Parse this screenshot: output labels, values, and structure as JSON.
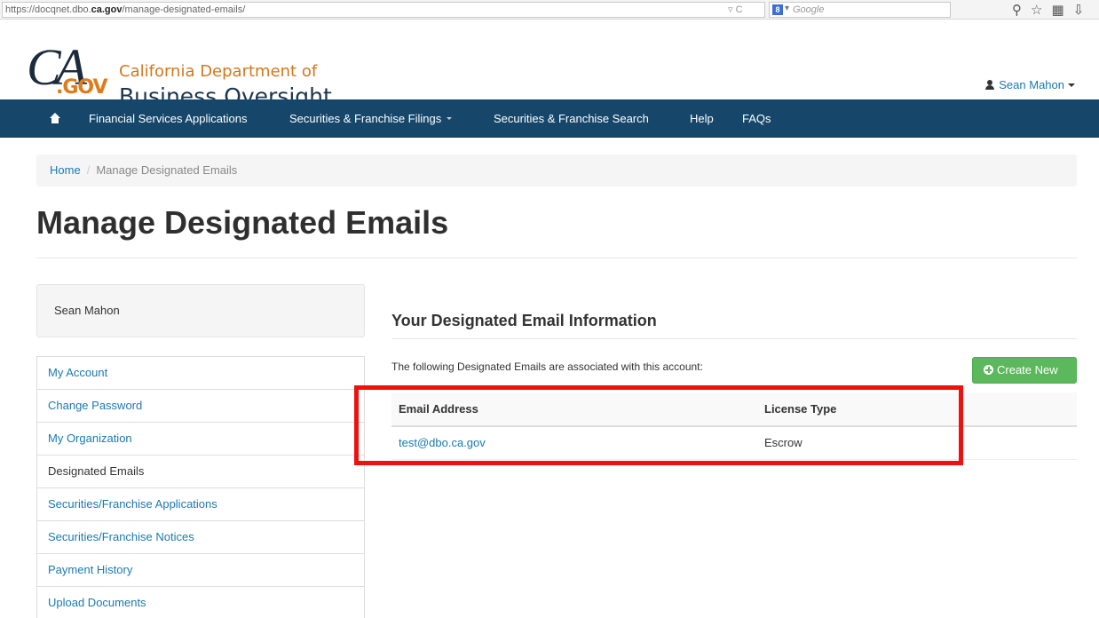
{
  "browser": {
    "url_prefix": "https://docqnet.dbo.",
    "url_domain": "ca.gov",
    "url_suffix": "/manage-designated-emails/",
    "search_placeholder": "Google",
    "search_engine_glyph": "8"
  },
  "header": {
    "logo_ca": "CA",
    "logo_gov": ".GOV",
    "dept_line1": "California Department of",
    "dept_line2": "Business Oversight",
    "user_name": "Sean Mahon"
  },
  "navbar": {
    "items": [
      {
        "label": "Financial Services Applications"
      },
      {
        "label": "Securities & Franchise Filings"
      },
      {
        "label": "Securities & Franchise Search"
      },
      {
        "label": "Help"
      },
      {
        "label": "FAQs"
      }
    ]
  },
  "breadcrumb": {
    "home": "Home",
    "separator": "/",
    "current": "Manage Designated Emails"
  },
  "page": {
    "title": "Manage Designated Emails"
  },
  "sidebar": {
    "user_name": "Sean Mahon",
    "items": [
      {
        "label": "My Account"
      },
      {
        "label": "Change Password"
      },
      {
        "label": "My Organization"
      },
      {
        "label": "Designated Emails"
      },
      {
        "label": "Securities/Franchise Applications"
      },
      {
        "label": "Securities/Franchise Notices"
      },
      {
        "label": "Payment History"
      },
      {
        "label": "Upload Documents"
      }
    ],
    "active_item": "Designated Emails"
  },
  "main": {
    "section_title": "Your Designated Email Information",
    "intro_text": "The following Designated Emails are associated with this account:",
    "create_button": "Create New",
    "table": {
      "headers": [
        "Email Address",
        "License Type"
      ],
      "rows": [
        {
          "email": "test@dbo.ca.gov",
          "license_type": "Escrow"
        }
      ]
    }
  },
  "colors": {
    "navbar": "#16476b",
    "link": "#1b79b0",
    "create_button": "#5cb85c",
    "highlight": "#ef1010",
    "dept_orange": "#d2781f"
  },
  "icons": [
    "user-icon",
    "home-icon",
    "plus-circle-icon",
    "reload-icon",
    "search-icon",
    "star-icon",
    "bookmarks-icon",
    "download-icon"
  ]
}
